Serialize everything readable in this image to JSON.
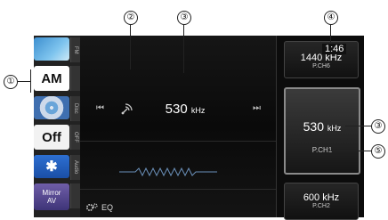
{
  "callouts": [
    "①",
    "②",
    "③",
    "④",
    "③",
    "⑤"
  ],
  "sources": {
    "fm_tab": "FM",
    "am_label": "AM",
    "disc_tab": "Disc",
    "off_label": "Off",
    "off_tab": "OFF",
    "bt_symbol": "✱",
    "audio_tab": "Audio",
    "mirror_label_1": "Mirror",
    "mirror_label_2": "AV"
  },
  "tuner": {
    "prev_icon": "⏮",
    "next_icon": "⏭",
    "frequency": "530",
    "unit": "kHz",
    "eq_label": "EQ"
  },
  "presets": [
    {
      "freq": "1440 kHz",
      "channel": "P.CH6"
    },
    {
      "freq": "530",
      "unit": "kHz",
      "channel": "P.CH1"
    },
    {
      "freq": "600 kHz",
      "channel": "P.CH2"
    }
  ],
  "clock": "1:46"
}
